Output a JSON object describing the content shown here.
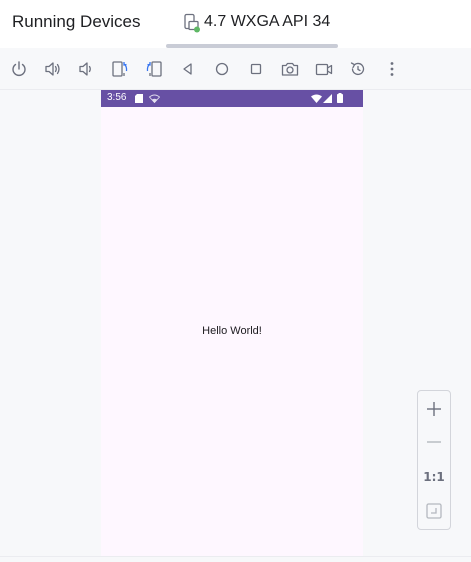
{
  "header": {
    "title": "Running Devices",
    "device_tab": {
      "label": "4.7 WXGA API 34",
      "icon": "phone-running-icon"
    }
  },
  "toolbar": {
    "buttons": [
      {
        "name": "power-button",
        "icon": "power-icon"
      },
      {
        "name": "volume-up-button",
        "icon": "volume-up-icon"
      },
      {
        "name": "volume-down-button",
        "icon": "volume-down-icon"
      },
      {
        "name": "rotate-left-button",
        "icon": "rotate-left-icon"
      },
      {
        "name": "rotate-right-button",
        "icon": "rotate-right-icon"
      },
      {
        "name": "back-button",
        "icon": "back-triangle-icon"
      },
      {
        "name": "home-button",
        "icon": "home-circle-icon"
      },
      {
        "name": "overview-button",
        "icon": "overview-square-icon"
      },
      {
        "name": "screenshot-button",
        "icon": "camera-icon"
      },
      {
        "name": "screen-record-button",
        "icon": "video-camera-icon"
      },
      {
        "name": "reset-orientation-button",
        "icon": "reset-icon"
      },
      {
        "name": "more-options-button",
        "icon": "kebab-icon"
      }
    ]
  },
  "device": {
    "status_bar": {
      "time": "3:56",
      "color": "#6750a4"
    },
    "content": {
      "text": "Hello World!"
    },
    "background": "#fef7ff"
  },
  "zoom": {
    "zoom_in": "zoom-in-icon",
    "zoom_out": "zoom-out-icon",
    "actual_size_label": "1:1",
    "fit": "fit-screen-icon"
  },
  "colors": {
    "accent_blue": "#3574f0",
    "icon_gray": "#6c707e",
    "running_green": "#5fb865"
  }
}
